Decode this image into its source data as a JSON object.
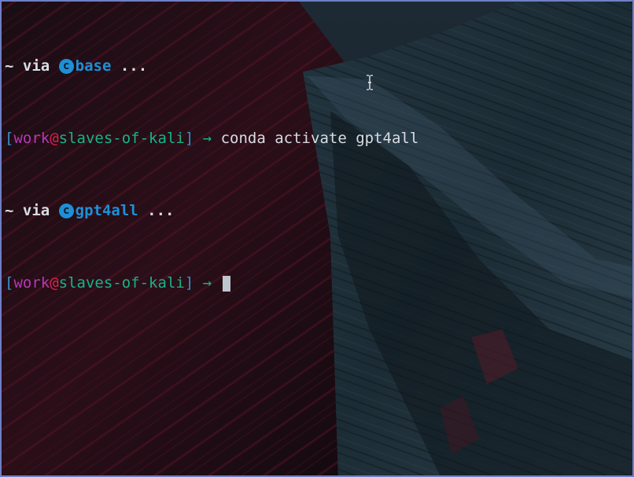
{
  "terminal": {
    "lines": [
      {
        "kind": "env",
        "tilde": "~",
        "via": " via ",
        "env_icon": "c",
        "env_name": "base",
        "ellipsis": " ..."
      },
      {
        "kind": "prompt",
        "open_bracket": "[",
        "user": "work",
        "at": "@",
        "host": "slaves-of-kali",
        "close_bracket": "]",
        "arrow": " → ",
        "command": "conda activate gpt4all"
      },
      {
        "kind": "env",
        "tilde": "~",
        "via": " via ",
        "env_icon": "c",
        "env_name": "gpt4all",
        "ellipsis": " ..."
      },
      {
        "kind": "prompt",
        "open_bracket": "[",
        "user": "work",
        "at": "@",
        "host": "slaves-of-kali",
        "close_bracket": "]",
        "arrow": " → ",
        "command": ""
      }
    ]
  },
  "icons": {
    "env_icon": "conda-circle-icon",
    "mouse_cursor": "ibeam-cursor-icon"
  },
  "colors": {
    "border": "#6f7fc6",
    "env": "#1e90d6",
    "user": "#b43ab4",
    "at": "#e0204a",
    "host": "#18b387",
    "bracket": "#3a8fd0",
    "text": "#d8dde3"
  }
}
